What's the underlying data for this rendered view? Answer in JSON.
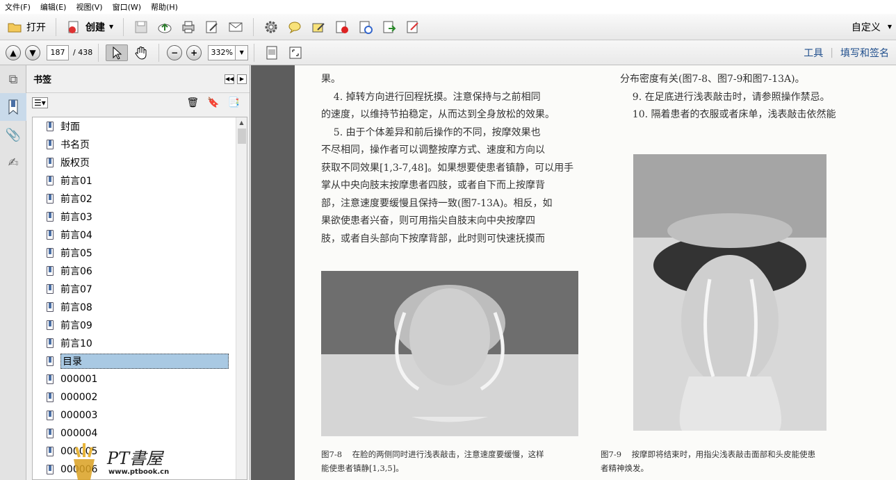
{
  "menu": [
    "文件(F)",
    "编辑(E)",
    "视图(V)",
    "窗口(W)",
    "帮助(H)"
  ],
  "toolbar": {
    "open_label": "打开",
    "create_label": "创建",
    "customize_label": "自定义",
    "icons": [
      "save-icon",
      "upload-icon",
      "print-icon",
      "edit-icon",
      "email-icon",
      "gear-icon",
      "comment-icon",
      "highlight-icon",
      "delete-page-icon",
      "rotate-icon",
      "export-icon",
      "form-icon"
    ]
  },
  "nav": {
    "current_page": "187",
    "total_pages": "/ 438",
    "zoom": "332%",
    "tools_label": "工具",
    "fill_sign_label": "填写和签名"
  },
  "bookmarks": {
    "title": "书签",
    "items": [
      "封面",
      "书名页",
      "版权页",
      "前言01",
      "前言02",
      "前言03",
      "前言04",
      "前言05",
      "前言06",
      "前言07",
      "前言08",
      "前言09",
      "前言10",
      "目录",
      "000001",
      "000002",
      "000003",
      "000004",
      "000005",
      "000006"
    ],
    "selected_index": 13
  },
  "document": {
    "left_col": [
      "果。",
      "    4. 掉转方向进行回程抚摸。注意保持与之前相同",
      "的速度，以维持节拍稳定，从而达到全身放松的效果。",
      "    5. 由于个体差异和前后操作的不同，按摩效果也",
      "不尽相同，操作者可以调整按摩方式、速度和方向以",
      "获取不同效果[1,3-7,48]。如果想要使患者镇静，可以用手",
      "掌从中央向肢末按摩患者四肢，或者自下而上按摩背",
      "部，注意速度要缓慢且保持一致(图7-13A)。相反，如",
      "果欲使患者兴奋，则可用指尖自肢末向中央按摩四",
      "肢，或者自头部向下按摩背部，此时则可快速抚摸而"
    ],
    "right_col": [
      "分布密度有关(图7-8、图7-9和图7-13A)。",
      "    9. 在足底进行浅表敲击时，请参照操作禁忌。",
      "    10. 隔着患者的衣服或者床单，浅表敲击依然能"
    ],
    "caption_left": [
      "图7-8    在脸的两侧同时进行浅表敲击，注意速度要缓慢，这样",
      "能使患者镇静[1,3,5]。"
    ],
    "caption_right": [
      "图7-9    按摩即将结束时，用指尖浅表敲击面部和头皮能使患",
      "者精神焕发。"
    ]
  },
  "watermark": {
    "brand": "PT書屋",
    "url": "www.ptbook.cn"
  }
}
